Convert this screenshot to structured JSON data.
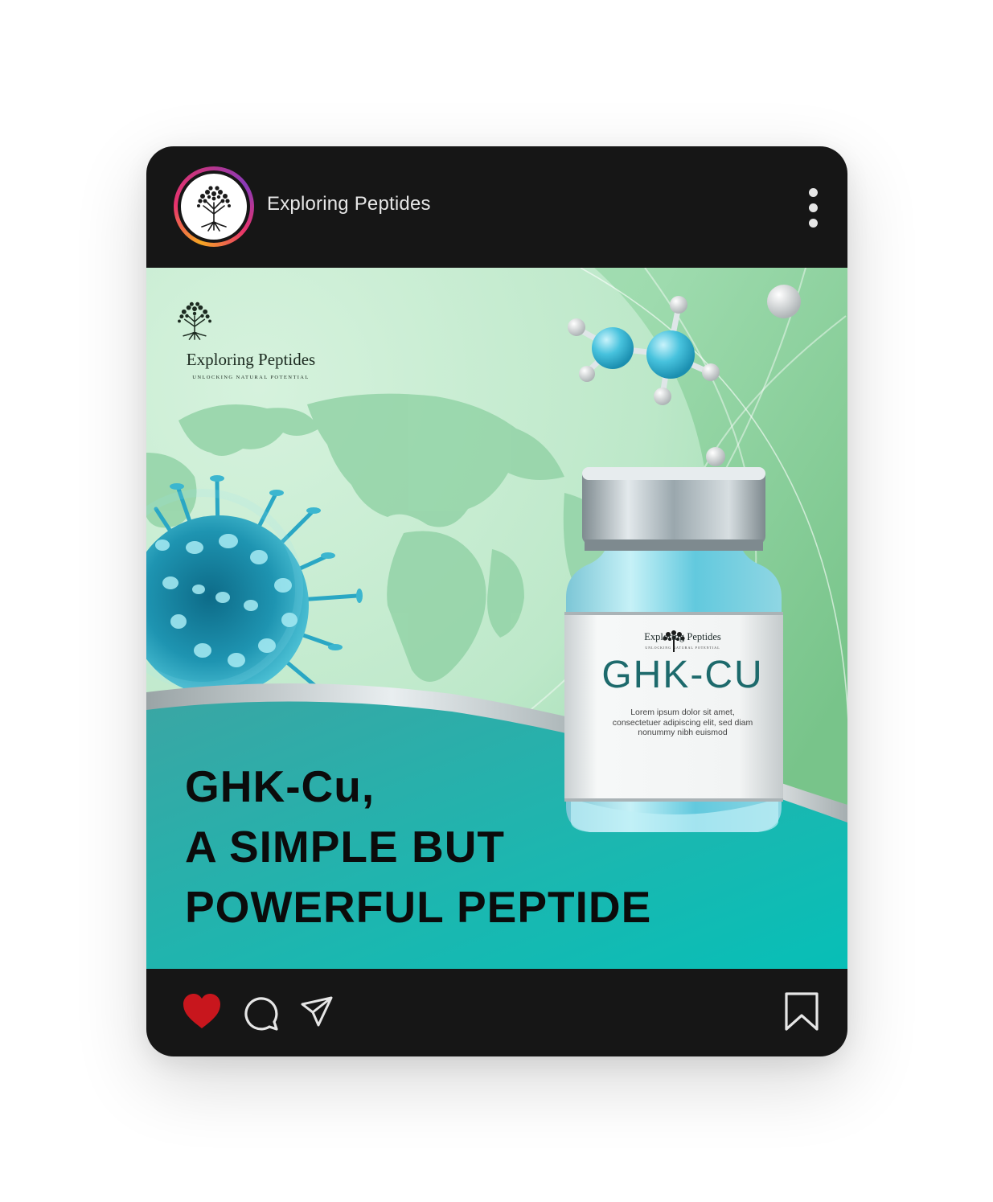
{
  "post": {
    "username": "Exploring Peptides",
    "brand": {
      "name": "Exploring Peptides",
      "tagline": "UNLOCKING NATURAL POTENTIAL"
    },
    "headline": [
      "GHK-Cu,",
      "A SIMPLE BUT",
      "POWERFUL PEPTIDE"
    ],
    "bottle_label": {
      "brand": "Exploring Peptides",
      "tagline": "UNLOCKING NATURAL POTENTIAL",
      "product": "GHK-CU",
      "body": "Lorem ipsum dolor sit amet, consectetuer adipiscing elit, sed diam nonummy nibh euismod"
    }
  },
  "actions": {
    "liked": true,
    "icons": [
      "heart-icon",
      "comment-icon",
      "share-icon",
      "bookmark-icon"
    ]
  },
  "colors": {
    "card_background": "#161616",
    "heart": "#c8161d",
    "teal": "#13b8b2",
    "green": "#8cd49c"
  }
}
